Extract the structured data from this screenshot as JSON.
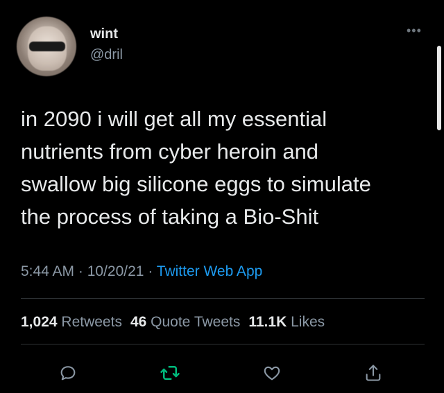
{
  "user": {
    "display_name": "wint",
    "handle": "@dril"
  },
  "tweet": {
    "text_lines": [
      "in 2090 i will get all my essential",
      "nutrients from cyber heroin and",
      "swallow big silicone eggs to simulate",
      "the process of taking a Bio-Shit"
    ],
    "time": "5:44 AM",
    "separator": " · ",
    "date": "10/20/21",
    "source": "Twitter Web App"
  },
  "stats": {
    "retweets_count": "1,024",
    "retweets_label": "Retweets",
    "quote_tweets_count": "46",
    "quote_tweets_label": "Quote Tweets",
    "likes_count": "11.1K",
    "likes_label": "Likes"
  },
  "icons": {
    "more": "more-horizontal-icon",
    "reply": "reply-icon",
    "retweet": "retweet-icon",
    "like": "heart-icon",
    "share": "share-icon"
  },
  "colors": {
    "background": "#000000",
    "text_primary": "#e7e9ea",
    "text_secondary": "#8b98a5",
    "link": "#1d9bf0",
    "retweet_accent": "#00ba7c",
    "divider": "#2f3336"
  }
}
